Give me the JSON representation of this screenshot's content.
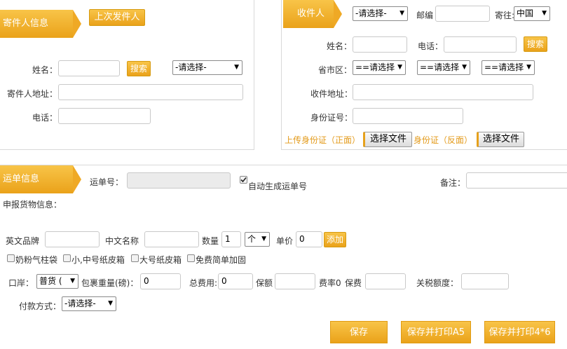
{
  "sender": {
    "tag": "寄件人信息",
    "last_sender_button": "上次发件人",
    "name_label": "姓名：",
    "search_button": "搜索",
    "select_value": "-请选择-",
    "address_label": "寄件人地址：",
    "phone_label": "电话："
  },
  "receiver": {
    "tag": "收件人",
    "select_value": "-请选择-",
    "postcode_label": "邮编",
    "ship_to_label": "寄往:",
    "country_value": "中国",
    "name_label": "姓名：",
    "phone_label": "电话：",
    "search_button": "搜索",
    "region_label": "省市区：",
    "province_value": "==请选择",
    "city_value": "==请选择",
    "district_value": "==请选择",
    "address_label": "收件地址：",
    "id_label": "身份证号：",
    "upload_front_label": "上传身份证（正面）",
    "choose_file_front": "选择文件",
    "upload_back_label": "身份证（反面）",
    "choose_file_back": "选择文件"
  },
  "waybill": {
    "tag": "运单信息",
    "number_label": "运单号：",
    "auto_generate_label": "自动生成运单号",
    "auto_generate_checked": true,
    "remark_label": "备注：",
    "declare_label": "申报货物信息：",
    "english_brand_label": "英文品牌",
    "chinese_name_label": "中文名称",
    "quantity_label": "数量",
    "quantity_value": "1",
    "unit_value": "个",
    "price_label": "单价",
    "price_value": "0",
    "add_button": "添加",
    "packaging": [
      {
        "label": "奶粉气柱袋"
      },
      {
        "label": "小,中号纸皮箱"
      },
      {
        "label": "大号纸皮箱"
      },
      {
        "label": "免费简单加固"
      }
    ],
    "port_label": "口岸：",
    "port_value": "普货 (",
    "weight_label": "包裹重量(磅)：",
    "weight_value": "0",
    "total_label": "总费用:",
    "total_value": "0",
    "insured_label": "保额",
    "rate_label": "费率0",
    "premium_label": "保费",
    "tax_label": "关税额度：",
    "payment_label": "付款方式：",
    "payment_value": "-请选择-"
  },
  "actions": {
    "save": "保存",
    "save_print_a5": "保存并打印A5",
    "save_print_4x6": "保存并打印4*6"
  }
}
